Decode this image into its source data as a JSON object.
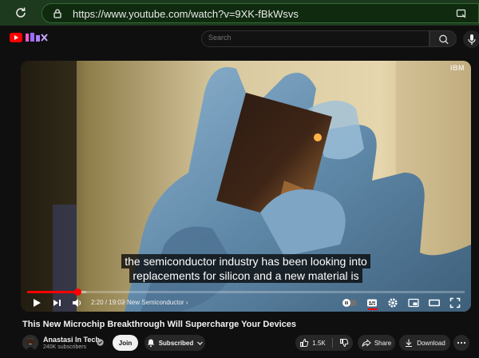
{
  "browser": {
    "url": "https://www.youtube.com/watch?v=9XK-fBkWsvs",
    "icons": [
      "reload-icon",
      "lock-icon",
      "site-info-icon"
    ]
  },
  "masthead": {
    "search_placeholder": "Search",
    "icons": [
      "youtube-logo",
      "search-icon",
      "mic-icon"
    ]
  },
  "player": {
    "watermark": "IBM",
    "captions": [
      "the semiconductor industry has been looking into",
      "replacements for silicon and a new material is"
    ],
    "progress_fraction": 0.1155,
    "buffered_fraction": 0.135,
    "current_time": "2:20",
    "duration": "19:02",
    "time_text": "2:20 / 19:02",
    "chapter_separator": "•",
    "chapter": "New Semiconductor",
    "controls": [
      "play-icon",
      "next-icon",
      "volume-icon",
      "autoplay-toggle",
      "subtitles-icon",
      "settings-icon",
      "miniplayer-icon",
      "theater-icon",
      "fullscreen-icon"
    ],
    "accent_color": "#ff0000"
  },
  "video": {
    "title": "This New Microchip Breakthrough Will Supercharge Your Devices"
  },
  "channel": {
    "name": "Anastasi In Tech",
    "subscribers": "240K subscribers",
    "join_label": "Join",
    "subscribed_label": "Subscribed"
  },
  "actions": {
    "likes": "1.5K",
    "share_label": "Share",
    "download_label": "Download"
  }
}
